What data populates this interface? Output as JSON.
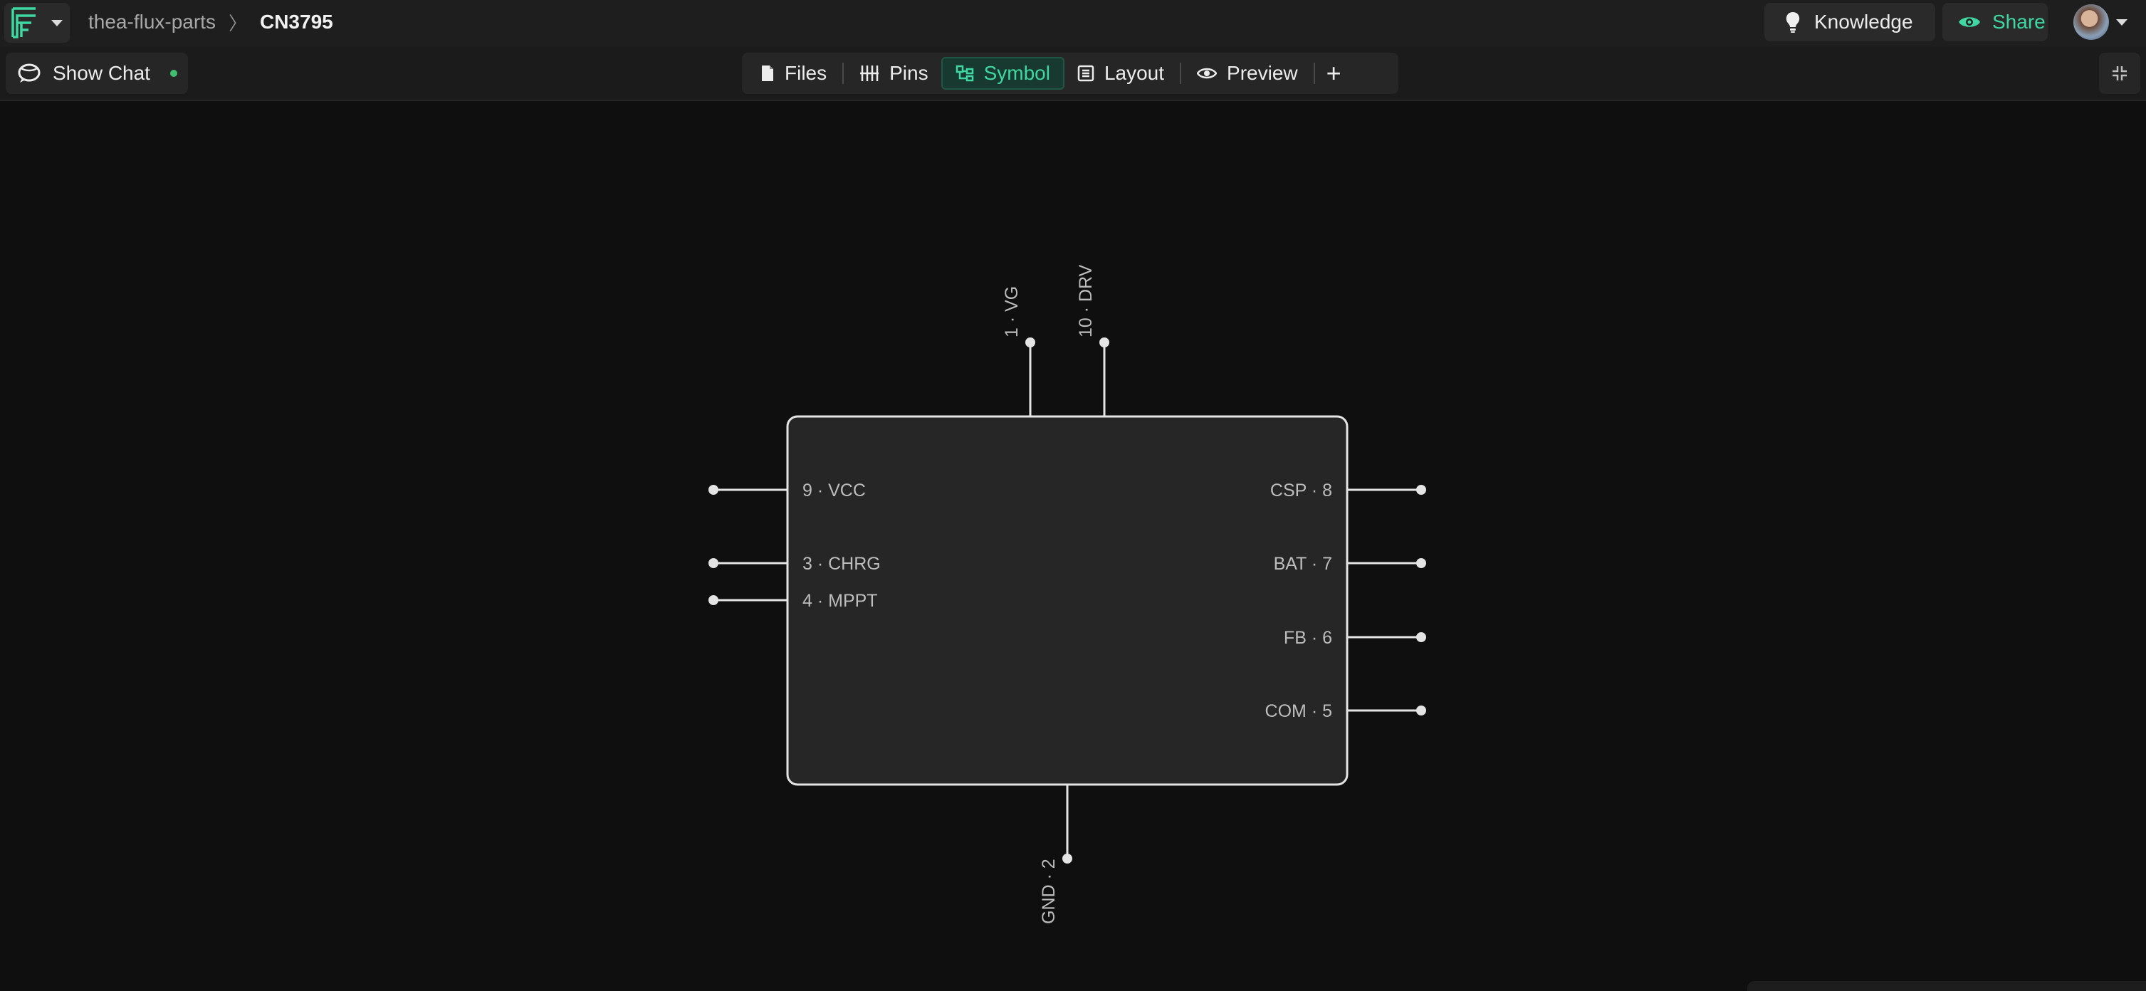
{
  "header": {
    "project": "thea-flux-parts",
    "separator": "〉",
    "part": "CN3795",
    "knowledge_label": "Knowledge",
    "share_label": "Share",
    "accent_color": "#3fd7a2"
  },
  "toolbar": {
    "chat_label": "Show Chat",
    "chat_status_color": "#3fbf6f",
    "tabs": [
      {
        "label": "Files",
        "icon": "file-icon"
      },
      {
        "label": "Pins",
        "icon": "pins-icon"
      },
      {
        "label": "Symbol",
        "icon": "symbol-icon",
        "active": true
      },
      {
        "label": "Layout",
        "icon": "layout-icon"
      },
      {
        "label": "Preview",
        "icon": "eye-icon"
      }
    ],
    "add_label": "+"
  },
  "symbol": {
    "pins_top": [
      "1 · VG",
      "10 · DRV"
    ],
    "pins_left": [
      "9 · VCC",
      "3 · CHRG",
      "4 · MPPT"
    ],
    "pins_right": [
      "CSP · 8",
      "BAT · 7",
      "FB · 6",
      "COM · 5"
    ],
    "pins_bottom": [
      "GND · 2"
    ]
  }
}
